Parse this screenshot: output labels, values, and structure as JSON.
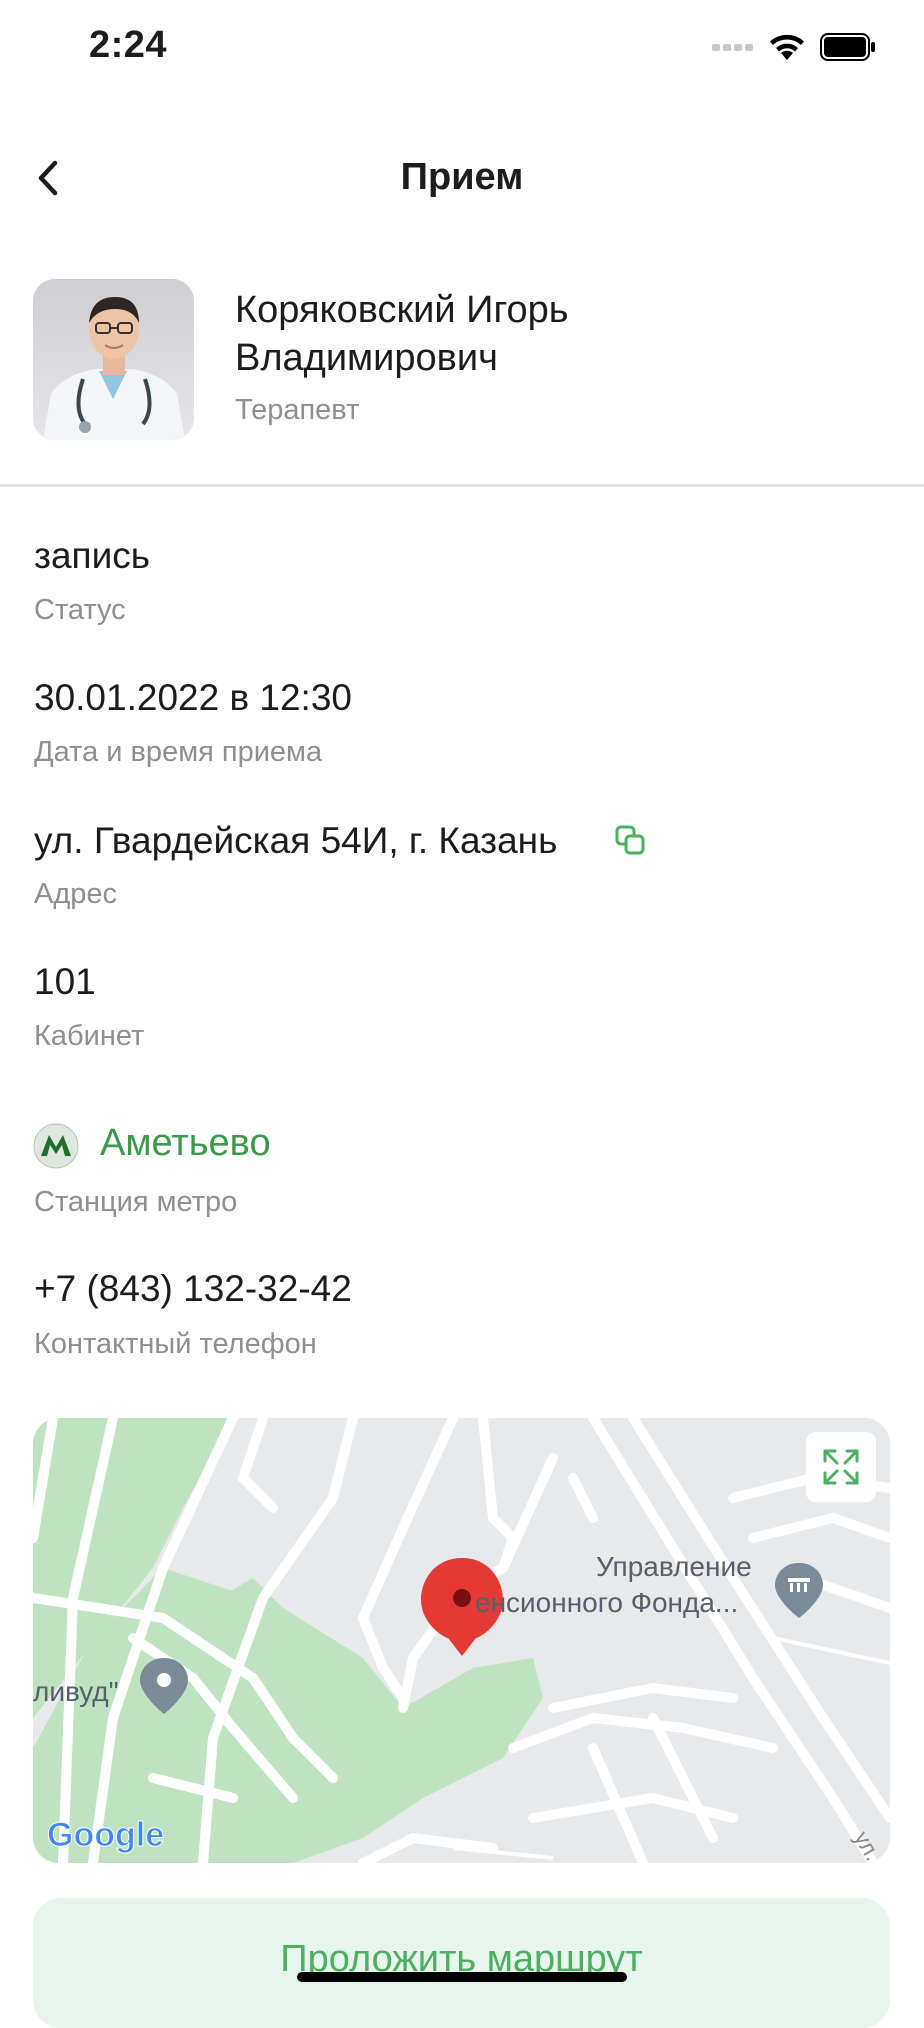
{
  "status_bar": {
    "time": "2:24"
  },
  "header": {
    "title": "Прием"
  },
  "doctor": {
    "name": "Коряковский Игорь Владимирович",
    "specialty": "Терапевт"
  },
  "fields": {
    "status": {
      "value": "запись",
      "label": "Статус"
    },
    "datetime": {
      "value": "30.01.2022 в 12:30",
      "label": "Дата и время приема"
    },
    "address": {
      "value": "ул. Гвардейская 54И, г. Казань",
      "label": "Адрес"
    },
    "cabinet": {
      "value": "101",
      "label": "Кабинет"
    },
    "metro": {
      "value": "Аметьево",
      "label": "Станция метро",
      "badge": "M"
    },
    "phone": {
      "value": "+7 (843) 132-32-42",
      "label": "Контактный телефон"
    }
  },
  "map": {
    "poi_1_line1": "Управление",
    "poi_1_line2": "енсионного Фонда...",
    "poi_2": "ливуд\"",
    "street": "ул.",
    "google_logo": "Google"
  },
  "actions": {
    "route_label": "Проложить маршрут"
  },
  "colors": {
    "accent": "#4caf61",
    "metro_green": "#3a9a49",
    "secondary_text": "#8e8e93",
    "route_button_bg": "#e7f5ec",
    "map_pin": "#e53935"
  },
  "icons": [
    "back-chevron-icon",
    "copy-icon",
    "metro-icon",
    "expand-icon",
    "map-pin-icon",
    "museum-icon",
    "wifi-icon",
    "battery-icon",
    "signal-icon"
  ]
}
